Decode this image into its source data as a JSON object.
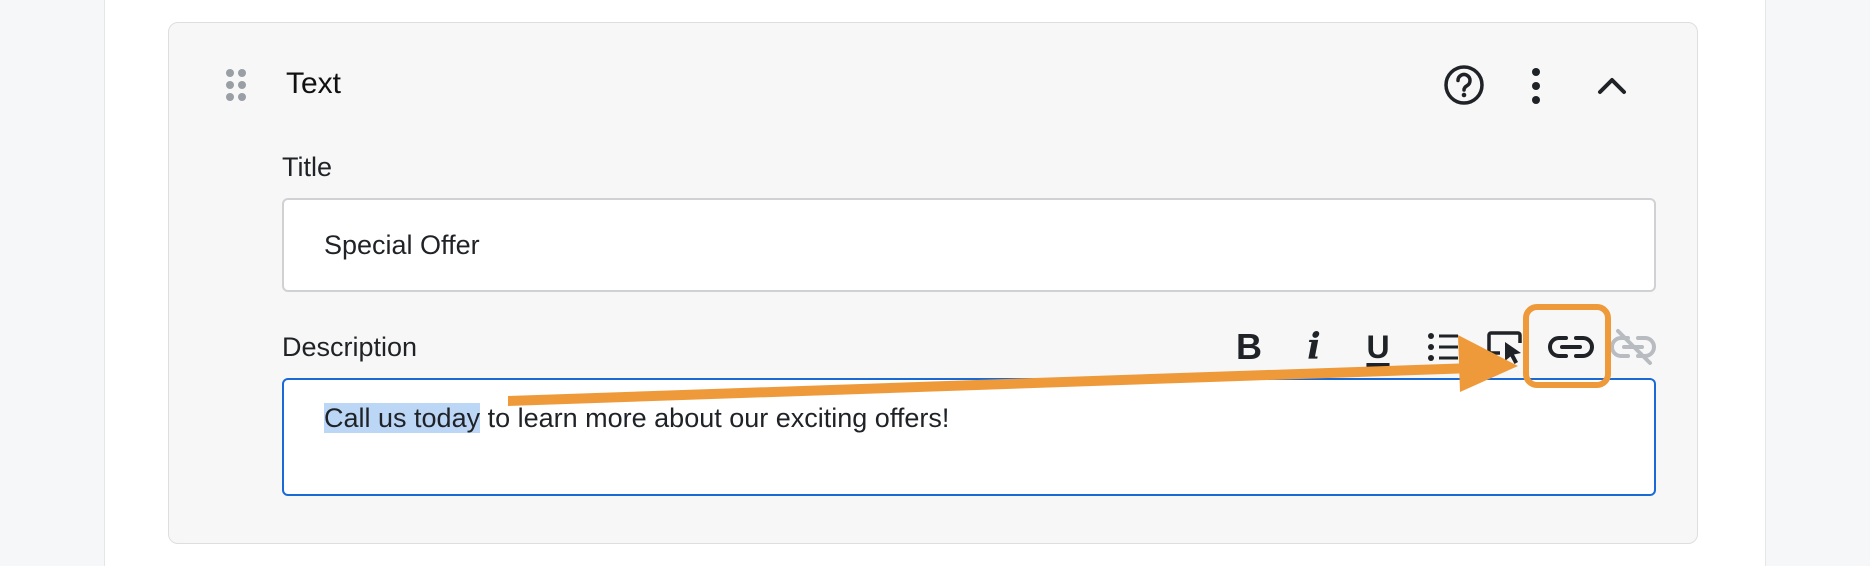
{
  "panel": {
    "title": "Text",
    "header_icons": [
      "drag-handle-icon",
      "help-circle-icon",
      "more-vertical-icon",
      "chevron-up-icon"
    ]
  },
  "title_field": {
    "label": "Title",
    "value": "Special Offer"
  },
  "description_field": {
    "label": "Description",
    "selected_text": "Call us today",
    "rest_text": " to learn more about our exciting offers!",
    "toolbar": {
      "bold_label": "B",
      "italic_label": "i",
      "underline_label": "U",
      "icons": [
        "bold-icon",
        "italic-icon",
        "underline-icon",
        "bulleted-list-icon",
        "cursor-select-icon",
        "link-icon",
        "unlink-icon"
      ]
    }
  },
  "colors": {
    "accent_focus": "#1a6ad6",
    "text_selection": "#bcd6f5",
    "annotation_orange": "#ef9a3a"
  }
}
